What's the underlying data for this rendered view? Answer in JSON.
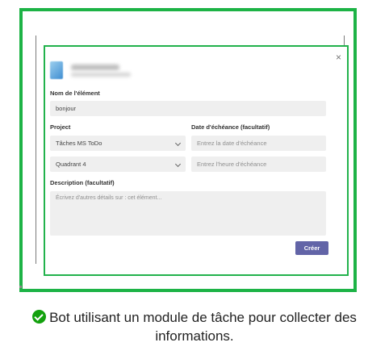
{
  "dialog": {
    "close_glyph": "×",
    "item_name_label": "Nom de l'élément",
    "item_name_value": "bonjour",
    "project_label": "Project",
    "project_value": "Tâches MS ToDo",
    "quadrant_value": "Quadrant 4",
    "due_date_label": "Date d'échéance (facultatif)",
    "due_date_placeholder": "Entrez la date d'échéance",
    "due_time_placeholder": "Entrez l'heure d'échéance",
    "description_label": "Description (facultatif)",
    "description_placeholder": "Écrivez d'autres détails sur : cet élément...",
    "create_button": "Créer"
  },
  "caption": {
    "line1": "Bot utilisant un module de tâche pour collecter des",
    "line2": "informations."
  },
  "colors": {
    "frame_green": "#1db346",
    "button_purple": "#6264a7",
    "check_green": "#13a10e"
  },
  "icons": [
    "close-icon",
    "chevron-down-icon",
    "check-circle-icon"
  ]
}
